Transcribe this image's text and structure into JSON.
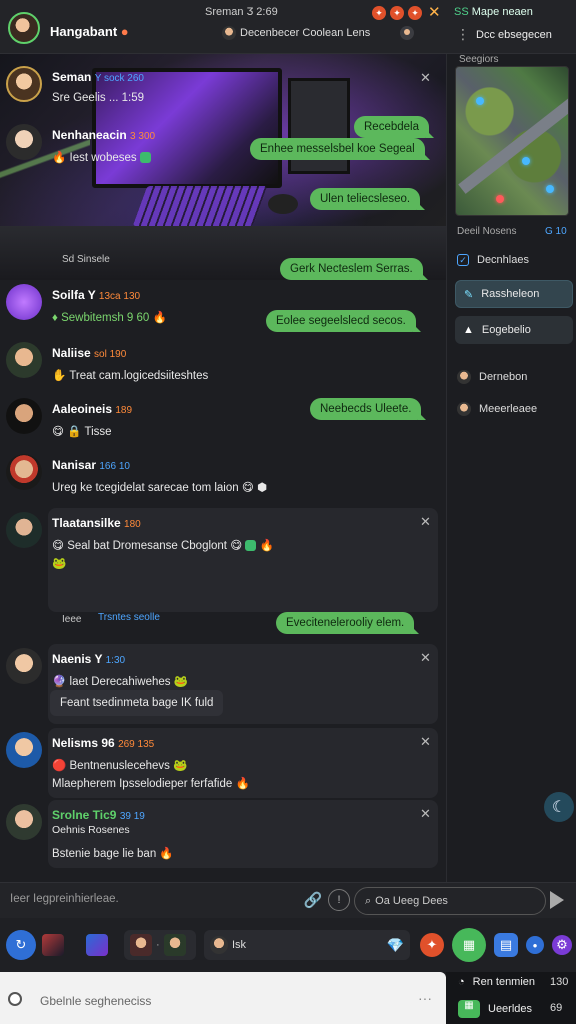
{
  "header": {
    "title": "Нangabant",
    "subtitle": "Sreman Ӡ 2:69",
    "channel": "Decenbecer Coolean Lens",
    "right_top": "Mape neaen",
    "right_top_prefix": "ЅЅ",
    "right_bottom": "Dcc ebsegecen",
    "icon_names": [
      "fire-icon",
      "fire-icon",
      "fire-icon",
      "close-icon",
      "gear-icon",
      "more-icon"
    ]
  },
  "banner": {
    "caption": "Sd Sinsele"
  },
  "messages": [
    {
      "name": "Seman",
      "meta": "Y sock 260",
      "text": "Sre Geelis ...   1:59"
    },
    {
      "name": "Nenhaneacin",
      "meta": "3 300",
      "text": "Iest wobeses"
    },
    {
      "name": "Soilfa Y",
      "meta": "13ca 130",
      "text": "Sewbitemsh 9 60"
    },
    {
      "name": "Naliise",
      "meta": "sol 190",
      "text": "Treat cam.logicedsiiteshtes"
    },
    {
      "name": "Aaleoineis",
      "meta": "189",
      "text": "Tisse"
    },
    {
      "name": "Nanisar",
      "meta": "166 10",
      "text": "Ureg ke tcegidelat sarecae tom laion"
    },
    {
      "name": "Tlaatansilke",
      "meta": "180",
      "text": "Seal bat Dromesanse Cboglont"
    },
    {
      "name": "Naenis Y",
      "meta": "1:30",
      "text": "laet Derecahiwehes"
    },
    {
      "name": "Nelisms 96",
      "meta": "269 135",
      "text": "Bentnenuslecehevs"
    },
    {
      "name": "Srolne Tic9",
      "meta": "39 19",
      "text": "Oehnis Rosenes"
    }
  ],
  "extra_lines": {
    "msg7_caption_left": "Ieee",
    "msg7_caption": "Trsntes seolle",
    "msg8_pill": "Feant tsedinmeta bage IK fuld",
    "msg9_line2": "Mlaepherem Ipsselodieper ferfafide",
    "msg10_line2": "Bstenie bage lie ban"
  },
  "outgoing": [
    "Recebdela",
    "Enhee messelsbel koe Segeal",
    "Ulen teliecsleseo.",
    "Gerk Necteslem Serras.",
    "Eolee segeelslecd secos.",
    "Neebecds Uleete.",
    "Evecitenelerooliy elem."
  ],
  "sidebar": {
    "title": "Seegiors",
    "map_label": "Deeil Nosens",
    "map_value": "G 10",
    "items": [
      {
        "label": "Decnhlaes",
        "icon": "check-icon"
      },
      {
        "label": "Rassheleon",
        "icon": "edit-icon"
      },
      {
        "label": "Eogebelio",
        "icon": "mountain-icon"
      },
      {
        "label": "Dernebon",
        "icon": "avatar"
      },
      {
        "label": "Meeerleaee",
        "icon": "avatar"
      }
    ]
  },
  "composer": {
    "placeholder": "Ieer Iegpreinhierleae.",
    "search_placeholder": "Oa Ueeg Dees"
  },
  "toolbar": {
    "text_field": "Isk",
    "icons": [
      "refresh-icon",
      "game-thumb",
      "game-thumb",
      "avatar-pair",
      "chat-field",
      "fire-icon",
      "apps-icon",
      "doc-icon",
      "info-icon",
      "settings-icon"
    ]
  },
  "bottom": {
    "input": "Gbelnle segheneciss",
    "side_rows": [
      {
        "label": "Ren tenmien",
        "value": "130"
      },
      {
        "label": "Ueerldes",
        "value": "69"
      }
    ]
  },
  "colors": {
    "accent_green": "#5cb85c",
    "bg": "#1b1c20",
    "card": "#27282d",
    "accent_blue": "#4ea6ff",
    "accent_orange": "#ff7a4a"
  }
}
